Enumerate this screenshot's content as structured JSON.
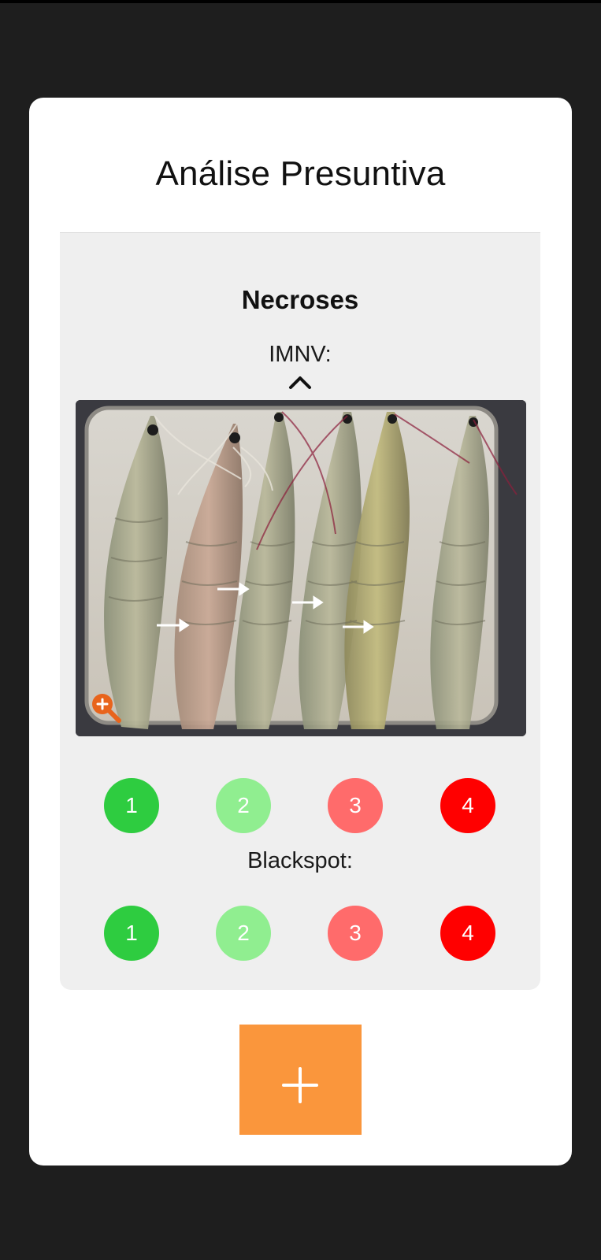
{
  "header": {
    "title": "Análise Presuntiva"
  },
  "section": {
    "title": "Necroses",
    "imnv_label": "IMNV:",
    "toggle_icon": "chevron-up-icon",
    "photo_zoom_icon": "zoom-in-icon",
    "blackspot_label": "Blackspot:"
  },
  "scores": {
    "imnv": [
      {
        "label": "1",
        "color": "#2ecc40"
      },
      {
        "label": "2",
        "color": "#90ee90"
      },
      {
        "label": "3",
        "color": "#ff6b6b"
      },
      {
        "label": "4",
        "color": "#ff0000"
      }
    ],
    "blackspot": [
      {
        "label": "1",
        "color": "#2ecc40"
      },
      {
        "label": "2",
        "color": "#90ee90"
      },
      {
        "label": "3",
        "color": "#ff6b6b"
      },
      {
        "label": "4",
        "color": "#ff0000"
      }
    ]
  },
  "actions": {
    "add_icon": "plus-icon",
    "add_color": "#fa963c"
  },
  "colors": {
    "background": "#1e1e1e",
    "card": "#ffffff",
    "panel": "#efefef",
    "zoom_icon": "#e8641c"
  }
}
